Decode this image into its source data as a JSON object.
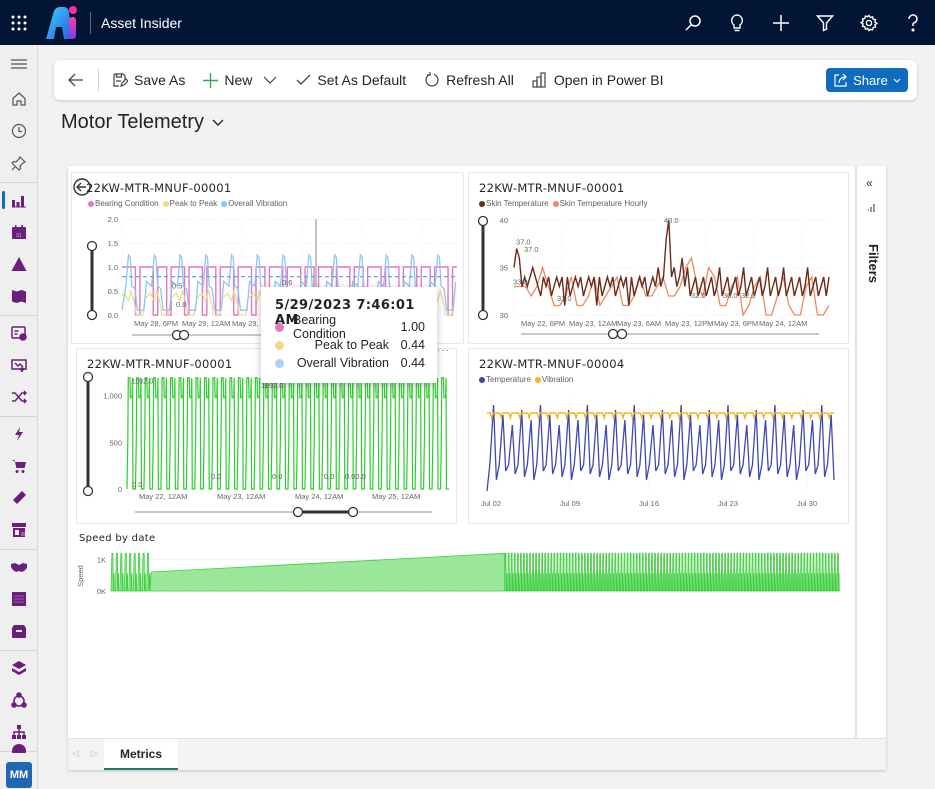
{
  "topbar": {
    "app_title": "Asset Insider",
    "icons": [
      "search-icon",
      "lightbulb-icon",
      "add-icon",
      "filter-icon",
      "settings-icon",
      "help-icon"
    ],
    "colors": {
      "background": "#031535"
    }
  },
  "sidebar": {
    "items": [
      {
        "name": "menu",
        "icon": "hamburger-icon"
      },
      {
        "name": "home",
        "icon": "home-icon"
      },
      {
        "name": "recent",
        "icon": "clock-icon"
      },
      {
        "name": "pinned",
        "icon": "pin-icon"
      },
      {
        "name": "dashboards",
        "icon": "bar-chart-icon",
        "active": true
      },
      {
        "name": "calendar",
        "icon": "calendar-icon"
      },
      {
        "name": "alerts",
        "icon": "warning-icon"
      },
      {
        "name": "knowledge",
        "icon": "book-icon"
      },
      {
        "name": "assets",
        "icon": "asset-card-icon"
      },
      {
        "name": "work-orders",
        "icon": "inbox-upload-icon"
      },
      {
        "name": "routing",
        "icon": "shuffle-icon"
      },
      {
        "name": "energy",
        "icon": "lightning-icon"
      },
      {
        "name": "purchasing",
        "icon": "cart-icon"
      },
      {
        "name": "parts",
        "icon": "tag-icon"
      },
      {
        "name": "vendors",
        "icon": "store-icon"
      },
      {
        "name": "contracts",
        "icon": "handshake-icon"
      },
      {
        "name": "documents",
        "icon": "document-icon"
      },
      {
        "name": "inventory",
        "icon": "box-icon"
      },
      {
        "name": "layers",
        "icon": "layers-icon"
      },
      {
        "name": "teams",
        "icon": "people-icon"
      },
      {
        "name": "hierarchy",
        "icon": "org-chart-icon"
      },
      {
        "name": "locations",
        "icon": "globe-icon"
      }
    ],
    "avatar_initials": "MM",
    "accent": "#6b1f7c"
  },
  "commandbar": {
    "back_label": "Back",
    "save_as": "Save As",
    "new": "New",
    "set_default": "Set As Default",
    "refresh_all": "Refresh All",
    "open_powerbi": "Open in Power BI",
    "share": "Share"
  },
  "page": {
    "title": "Motor Telemetry"
  },
  "report": {
    "filters_label": "Filters",
    "tabs": [
      {
        "label": "Metrics",
        "active": true
      }
    ],
    "tooltip": {
      "title": "5/29/2023 7:46:01 AM",
      "rows": [
        {
          "label": "Bearing Condition",
          "value": "1.00",
          "color": "#e377c2"
        },
        {
          "label": "Peak to Peak",
          "value": "0.44",
          "color": "#f0d98a"
        },
        {
          "label": "Overall Vibration",
          "value": "0.44",
          "color": "#9ecbf5"
        }
      ]
    }
  },
  "chart_data": [
    {
      "id": "vibration",
      "type": "line",
      "title": "22KW-MTR-MNUF-00001",
      "series": [
        {
          "name": "Bearing Condition",
          "color": "#e377c2"
        },
        {
          "name": "Peak to Peak",
          "color": "#f0d98a"
        },
        {
          "name": "Overall Vibration",
          "color": "#8ec5f5"
        }
      ],
      "x_ticks": [
        "May 28, 6PM",
        "May 29, 12AM",
        "May 29, 6AM"
      ],
      "y_ticks": [
        "0.0",
        "0.5",
        "1.0",
        "1.5",
        "2.0"
      ],
      "ylim": [
        0,
        2
      ],
      "reference_line": 0.8,
      "annotations": [
        "0.5",
        "0.0",
        "0.6"
      ],
      "bearing_pattern": [
        1,
        1,
        1,
        0,
        1,
        1,
        1,
        0,
        1,
        1,
        0,
        1,
        1,
        1,
        0,
        1,
        1,
        1,
        0,
        1,
        1,
        0,
        1,
        1,
        1,
        0,
        1,
        1,
        1,
        0,
        1,
        1,
        0,
        1,
        1,
        1,
        0,
        1,
        1,
        1,
        0,
        1,
        1,
        0,
        1,
        1,
        1,
        0,
        1,
        1,
        1,
        0,
        1,
        1,
        0,
        1,
        1,
        1,
        0,
        1,
        1,
        1,
        0,
        1,
        1,
        1,
        0,
        1,
        1,
        0,
        1,
        1,
        1,
        0,
        1
      ],
      "vibration_peaks": 13
    },
    {
      "id": "skin-temp",
      "type": "line",
      "title": "22KW-MTR-MNUF-00001",
      "series": [
        {
          "name": "Skin Temperature",
          "color": "#6b2c1a"
        },
        {
          "name": "Skin Temperature Hourly",
          "color": "#ef8a5f"
        }
      ],
      "x_ticks": [
        "May 22, 6PM",
        "May 23, 12AM",
        "May 23, 6AM",
        "May 23, 12PM",
        "May 23, 6PM",
        "May 24, 12AM"
      ],
      "y_ticks": [
        "30",
        "35",
        "40"
      ],
      "ylim": [
        30,
        40
      ],
      "annotations": [
        "37.0",
        "37.0",
        "33.0",
        "31.0",
        "40.0",
        "32.0",
        "30.0",
        "32.0"
      ],
      "skin_temperature": [
        35,
        37,
        36,
        33,
        34,
        33,
        34,
        35,
        34,
        33,
        32,
        34,
        33,
        34,
        32,
        33,
        34,
        33,
        34,
        31,
        34,
        32,
        33,
        34,
        33,
        34,
        32,
        33,
        34,
        33,
        34,
        31,
        34,
        32,
        33,
        34,
        33,
        34,
        32,
        33,
        34,
        33,
        34,
        31,
        34,
        32,
        33,
        34,
        33,
        34,
        32,
        33,
        34,
        33,
        35,
        33,
        34,
        38,
        40,
        34,
        35,
        33,
        34,
        36,
        33,
        35,
        32,
        33,
        34,
        32,
        33,
        34,
        32,
        33,
        34,
        32,
        33,
        35,
        32,
        33,
        34,
        32,
        33,
        34,
        32,
        33,
        35,
        32,
        33,
        34,
        32,
        33,
        34,
        32,
        33,
        35,
        32,
        33,
        34,
        32,
        33,
        35,
        32,
        33,
        34,
        32,
        33,
        34,
        32,
        33,
        35,
        32,
        33,
        34,
        32,
        33,
        34,
        32,
        34
      ],
      "skin_temperature_hourly": [
        33,
        33,
        33,
        32,
        33,
        35,
        33,
        31,
        31,
        32,
        34,
        31,
        31,
        32,
        34,
        31,
        32,
        33,
        34,
        31,
        31,
        32,
        34,
        32,
        32,
        33,
        34,
        32,
        32,
        33,
        35,
        36,
        33,
        32,
        35,
        34,
        31,
        31,
        33,
        34,
        30,
        31,
        33,
        34,
        30,
        30,
        32,
        34,
        31,
        30,
        30,
        33,
        34,
        30,
        30,
        31
      ]
    },
    {
      "id": "speed-00001",
      "type": "line",
      "title": "22KW-MTR-MNUF-00001",
      "series": [
        {
          "name": "Speed",
          "color": "#2ecc2e"
        }
      ],
      "x_ticks": [
        "May 22, 12AM",
        "May 23, 12AM",
        "May 24, 12AM",
        "May 25, 12AM"
      ],
      "y_ticks": [
        "0",
        "500",
        "1,000"
      ],
      "ylim": [
        0,
        1200
      ],
      "annotations": [
        "1192.0",
        "0.0",
        "0.0",
        "0.0",
        "0.0",
        "0.00.0",
        "1192.0"
      ],
      "cycles": 38
    },
    {
      "id": "temp-vib-00004",
      "type": "line",
      "title": "22KW-MTR-MNUF-00004",
      "series": [
        {
          "name": "Temperature",
          "color": "#3f48b0"
        },
        {
          "name": "Vibration",
          "color": "#f5b325"
        }
      ],
      "x_ticks": [
        "Jul 02",
        "Jul 09",
        "Jul 16",
        "Jul 23",
        "Jul 30"
      ],
      "cycles": 37
    },
    {
      "id": "speed-by-date",
      "type": "area",
      "title": "Speed by date",
      "ylabel": "Speed",
      "series": [
        {
          "name": "Speed",
          "color": "#5cd65c"
        }
      ],
      "y_ticks": [
        "0K",
        "1K"
      ],
      "ylim": [
        0,
        1200
      ],
      "segments": [
        {
          "from": 0,
          "to": 0.055,
          "pattern": "oscillating"
        },
        {
          "from": 0.055,
          "to": 0.54,
          "pattern": "ramp",
          "start": 600,
          "end": 1190
        },
        {
          "from": 0.54,
          "to": 1,
          "pattern": "oscillating"
        }
      ]
    }
  ]
}
